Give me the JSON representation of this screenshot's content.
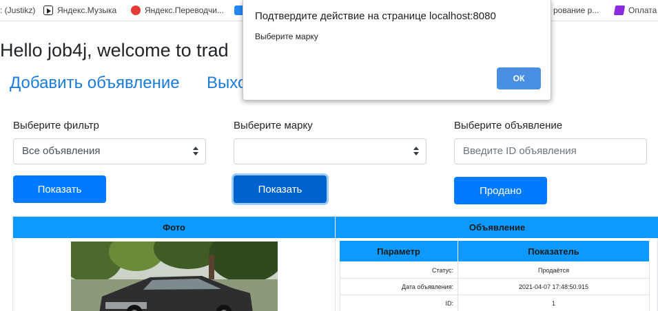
{
  "bookmarks": [
    {
      "label": ": (Justikz)",
      "icon": "none"
    },
    {
      "label": "Яндекс.Музыка",
      "icon": "play-icon"
    },
    {
      "label": "Яндекс.Переводчи...",
      "icon": "translate-icon"
    },
    {
      "label": "",
      "icon": "vk-icon"
    },
    {
      "label": "рование р...",
      "icon": "none"
    },
    {
      "label": "Оплата",
      "icon": "payment-icon"
    }
  ],
  "page": {
    "greeting": "Hello job4j, welcome to trad",
    "nav": {
      "add_ad": "Добавить объявление",
      "logout": "Выхо"
    },
    "filter": {
      "label": "Выберите фильтр",
      "selected": "Все объявления",
      "button": "Показать"
    },
    "brand": {
      "label": "Выберите марку",
      "selected": "",
      "button": "Показать"
    },
    "ad": {
      "label": "Выберите объявление",
      "placeholder": "Введите ID объявления",
      "button": "Продано"
    }
  },
  "table": {
    "headers": [
      "Фото",
      "Объявление"
    ],
    "sub_headers": [
      "Параметр",
      "Показатель"
    ],
    "rows": [
      {
        "param": "Статус:",
        "value": "Продаётся"
      },
      {
        "param": "Дата объявления:",
        "value": "2021-04-07 17:48:50.915"
      },
      {
        "param": "ID:",
        "value": "1"
      }
    ]
  },
  "dialog": {
    "title": "Подтвердите действие на странице localhost:8080",
    "message": "Выберите марку",
    "ok": "ОК"
  },
  "colors": {
    "primary": "#007bff",
    "table_header": "#0d99ff",
    "link": "#1a7bd8",
    "dialog_ok": "#4a90e2"
  }
}
